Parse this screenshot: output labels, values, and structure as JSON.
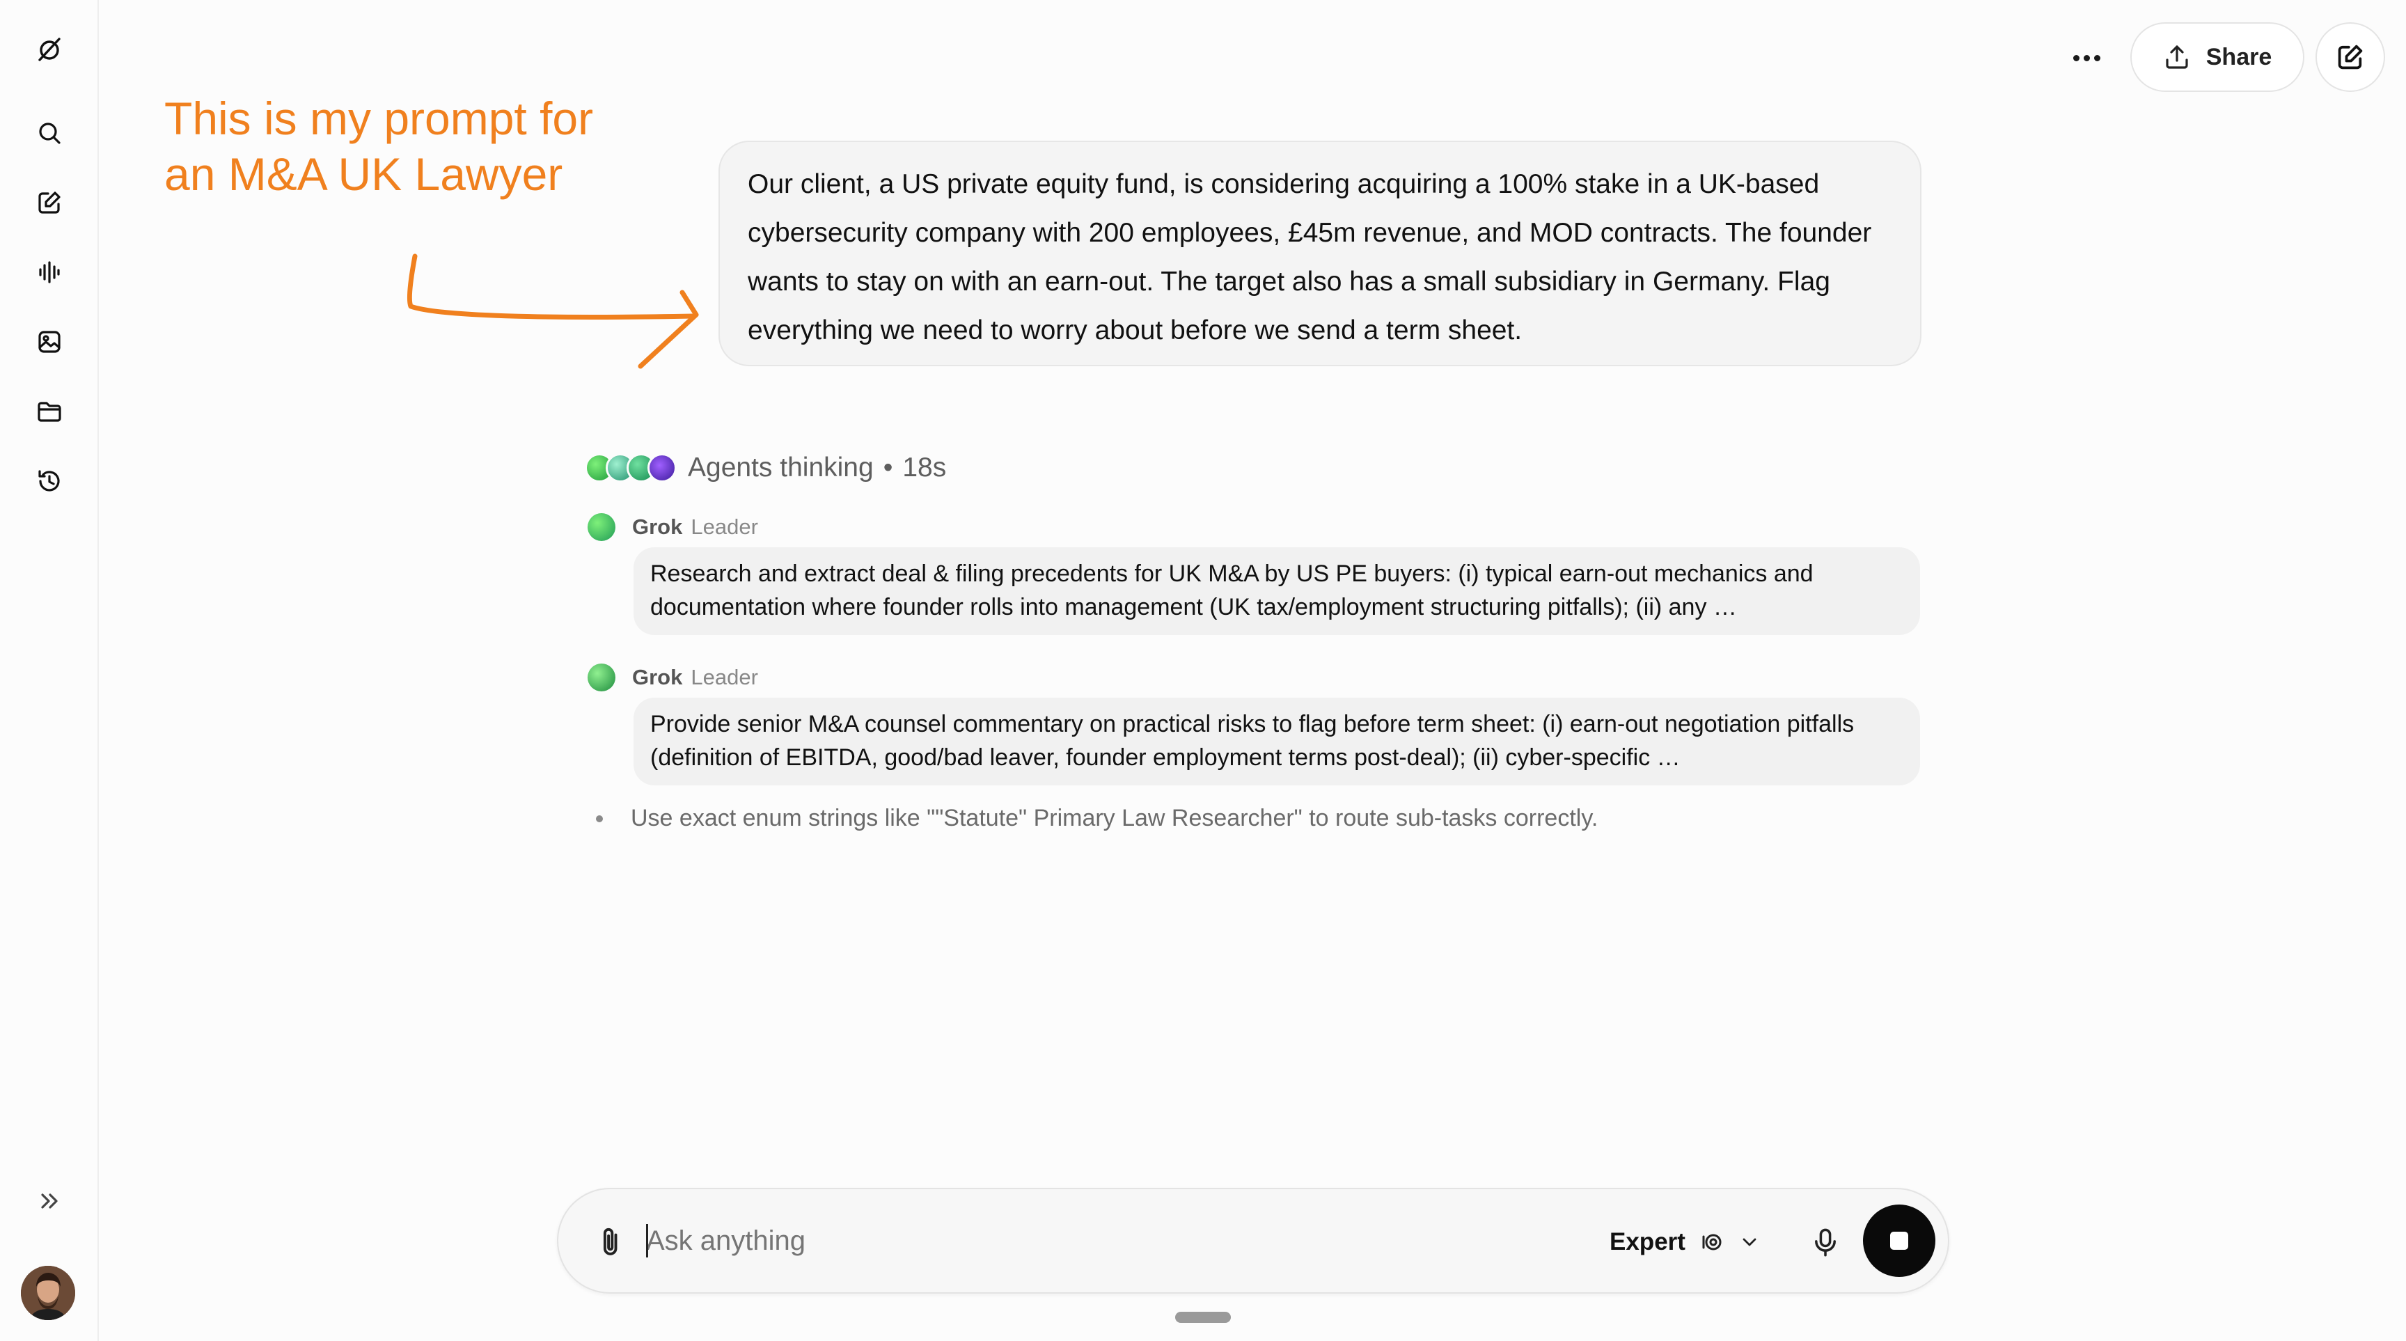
{
  "annotation": {
    "line1": "This is my prompt for",
    "line2": "an M&A UK Lawyer",
    "color": "#f0801e"
  },
  "topbar": {
    "more_icon": "ellipsis-icon",
    "share_label": "Share",
    "share_icon": "upload-icon",
    "new_chat_icon": "compose-icon"
  },
  "sidebar": {
    "items": [
      {
        "icon": "grok-logo-icon"
      },
      {
        "icon": "search-icon"
      },
      {
        "icon": "compose-icon"
      },
      {
        "icon": "voice-waveform-icon"
      },
      {
        "icon": "imagine-icon"
      },
      {
        "icon": "folder-icon"
      },
      {
        "icon": "history-icon"
      },
      {
        "icon": "expand-icon"
      }
    ]
  },
  "user_message": "Our client, a US private equity fund, is considering acquiring a 100% stake in a UK-based cybersecurity company with 200 employees, £45m revenue, and MOD contracts. The founder wants to stay on with an earn-out. The target also has a small subsidiary in Germany. Flag everything we need to worry about before we send a term sheet.",
  "thinking": {
    "label": "Agents thinking",
    "separator": "•",
    "elapsed": "18s"
  },
  "agents": [
    {
      "name": "Grok",
      "role": "Leader",
      "text": "Research and extract deal & filing precedents for UK M&A by US PE buyers: (i) typical earn-out mechanics and documentation where founder rolls into management (UK tax/employment structuring pitfalls); (ii) any …"
    },
    {
      "name": "Grok",
      "role": "Leader",
      "text": "Provide senior M&A counsel commentary on practical risks to flag before term sheet: (i) earn-out negotiation pitfalls (definition of EBITDA, good/bad leaver, founder employment terms post-deal); (ii) cyber-specific …"
    }
  ],
  "bullet_note": "Use exact enum strings like \"\"Statute\" Primary Law Researcher\" to route sub-tasks correctly.",
  "composer": {
    "placeholder": "Ask anything",
    "mode_label": "Expert"
  }
}
